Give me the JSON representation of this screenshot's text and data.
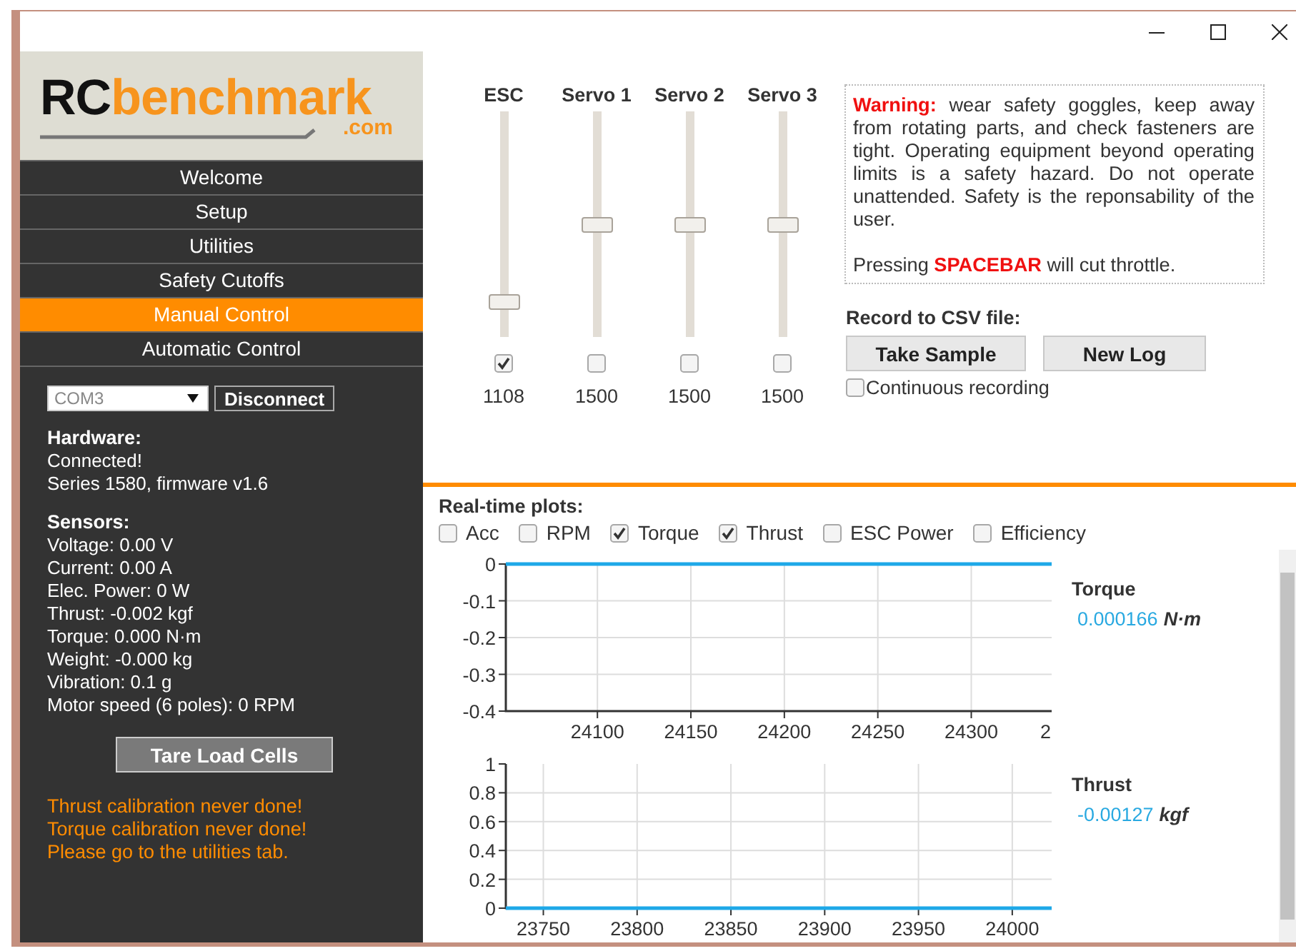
{
  "logo": {
    "brand": "**RC**benchmark",
    "domain": ".com"
  },
  "sidebar": {
    "items": [
      {
        "label": "Welcome",
        "selected": false
      },
      {
        "label": "Setup",
        "selected": false
      },
      {
        "label": "Utilities",
        "selected": false
      },
      {
        "label": "Safety Cutoffs",
        "selected": false
      },
      {
        "label": "Manual Control",
        "selected": true
      },
      {
        "label": "Automatic Control",
        "selected": false
      }
    ],
    "port": {
      "value": "COM3"
    },
    "connect_button": "Disconnect",
    "hardware": {
      "title": "Hardware:",
      "lines": [
        "Connected!",
        "Series 1580, firmware v1.6"
      ]
    },
    "sensors": {
      "title": "Sensors:",
      "lines": [
        "Voltage: 0.00 V",
        "Current: 0.00 A",
        "Elec. Power: 0 W",
        "Thrust: -0.002 kgf",
        "Torque: 0.000 N·m",
        "Weight: -0.000 kg",
        "Vibration: 0.1 g",
        "Motor speed (6 poles): 0 RPM"
      ]
    },
    "tare_button": "Tare Load Cells",
    "warnings": [
      "Thrust calibration never done!",
      "Torque calibration never done!",
      "Please go to the utilities tab."
    ]
  },
  "channels": [
    {
      "name": "ESC",
      "level": 0.13,
      "checked": true,
      "reading": "1108"
    },
    {
      "name": "Servo 1",
      "level": 0.5,
      "checked": false,
      "reading": "1500"
    },
    {
      "name": "Servo 2",
      "level": 0.5,
      "checked": false,
      "reading": "1500"
    },
    {
      "name": "Servo 3",
      "level": 0.5,
      "checked": false,
      "reading": "1500"
    }
  ],
  "warning_box": {
    "paragraphs": [
      "**Warning:** wear safety goggles, keep away from rotating parts, and check fasteners are tight. Operating equipment beyond operating limits is a safety hazard. Do not operate unattended. Safety is the reponsability of the user.",
      "Pressing **SPACEBAR** will cut throttle."
    ]
  },
  "record": {
    "title": "Record to CSV file:",
    "buttons": [
      "Take Sample",
      "New Log"
    ],
    "continuous": {
      "label": "Continuous recording",
      "checked": false
    }
  },
  "plots": {
    "title": "Real-time plots:",
    "toggles": [
      {
        "label": "Acc",
        "checked": false
      },
      {
        "label": "RPM",
        "checked": false
      },
      {
        "label": "Torque",
        "checked": true
      },
      {
        "label": "Thrust",
        "checked": true
      },
      {
        "label": "ESC Power",
        "checked": false
      },
      {
        "label": "Efficiency",
        "checked": false
      }
    ],
    "panels": [
      {
        "name": "Torque",
        "value": "0.000166",
        "unit": "N·m",
        "chart_data": {
          "type": "line",
          "x": [
            24051,
            24100,
            24150,
            24200,
            24250,
            24300,
            24343
          ],
          "series": [
            {
              "color": "#1ea8e8",
              "values": [
                0,
                0,
                0,
                0,
                0,
                0,
                0
              ]
            }
          ],
          "xlim": [
            24051,
            24343
          ],
          "ylim": [
            -0.4,
            0
          ],
          "grid": true,
          "xticks": [
            24100,
            24150,
            24200,
            24250,
            24300
          ],
          "yticks": [
            0,
            -0.1,
            -0.2,
            -0.3,
            -0.4
          ]
        },
        "cut_tick_label": "2"
      },
      {
        "name": "Thrust",
        "value": "-0.00127",
        "unit": "kgf",
        "chart_data": {
          "type": "line",
          "x": [
            23730,
            23800,
            23850,
            23900,
            23950,
            24000,
            24021
          ],
          "series": [
            {
              "color": "#1ea8e8",
              "values": [
                0,
                0,
                0,
                0,
                0,
                0,
                0
              ]
            }
          ],
          "xlim": [
            23730,
            24021
          ],
          "ylim": [
            0,
            1
          ],
          "grid": true,
          "xticks": [
            23750,
            23800,
            23850,
            23900,
            23950,
            24000
          ],
          "yticks": [
            0,
            0.2,
            0.4,
            0.6,
            0.8,
            1
          ]
        }
      }
    ]
  }
}
